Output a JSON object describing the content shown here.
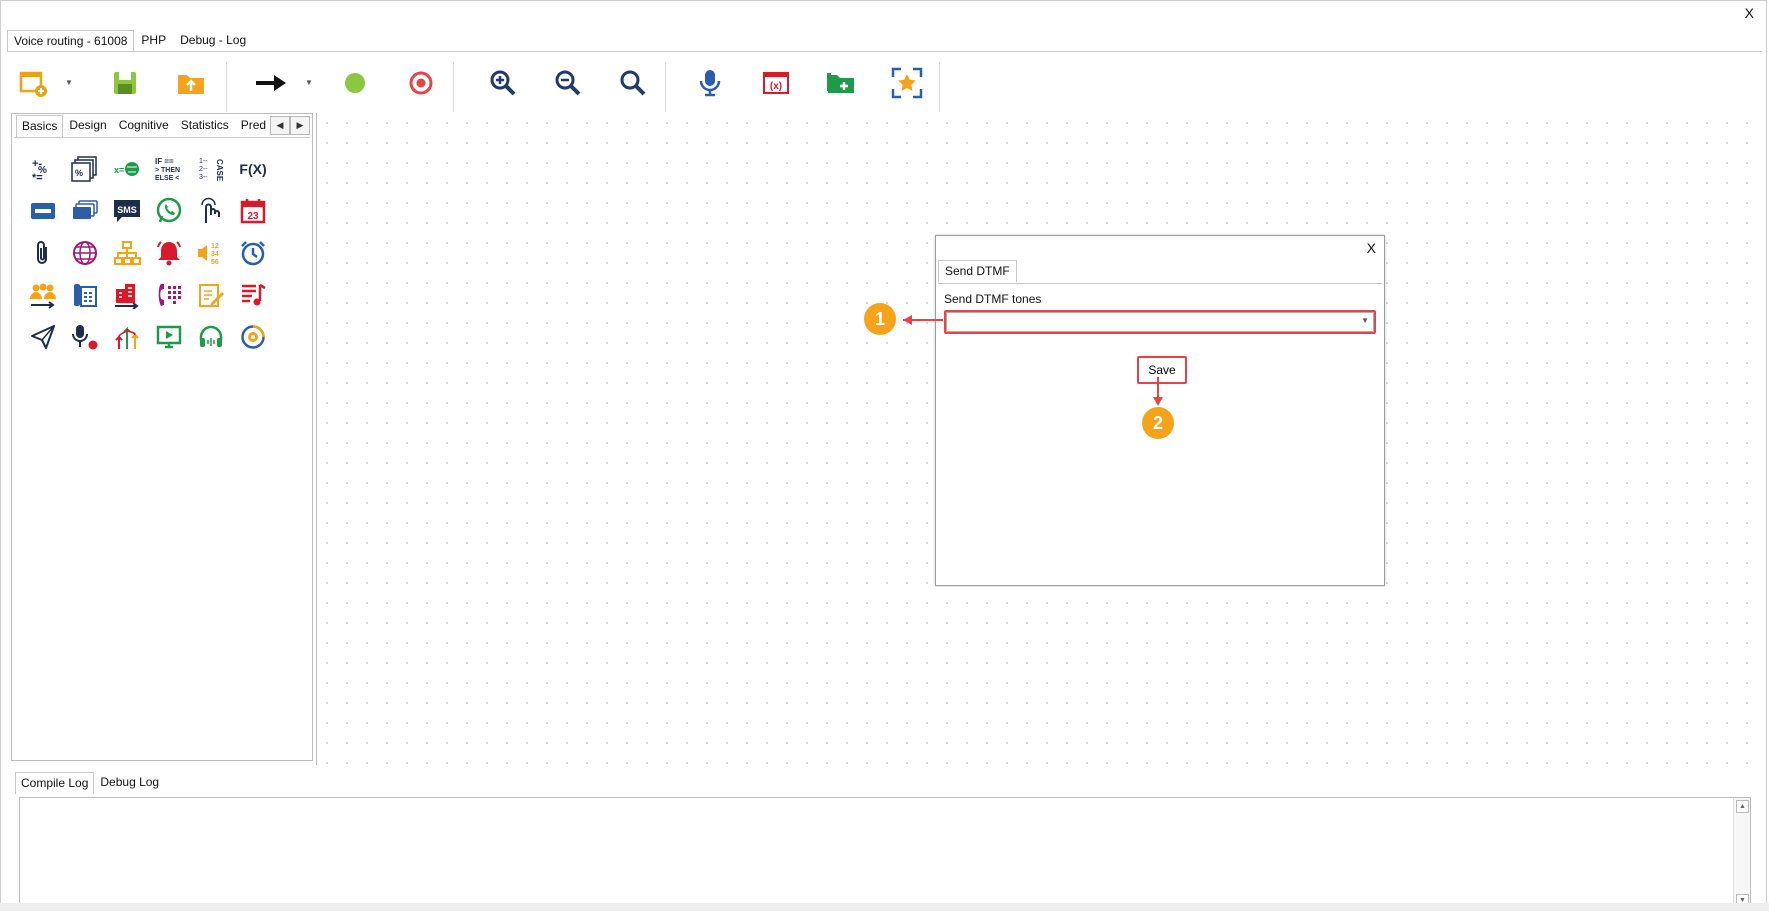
{
  "window": {
    "close_label": "X"
  },
  "main_tabs": [
    {
      "label": "Voice routing - 61008"
    },
    {
      "label": "PHP"
    },
    {
      "label": "Debug - Log"
    }
  ],
  "palette": {
    "tabs": [
      "Basics",
      "Design",
      "Cognitive",
      "Statistics",
      "Pred"
    ],
    "scroll_left": "◀",
    "scroll_right": "▶",
    "icons": [
      "math-operators-icon",
      "percentage-layers-icon",
      "variable-globe-icon",
      "if-then-else-icon",
      "case-icon",
      "function-fx-icon",
      "card-icon",
      "cards-stack-icon",
      "sms-icon",
      "whatsapp-icon",
      "touch-keypad-icon",
      "calendar-23-icon",
      "paperclip-icon",
      "globe-icon",
      "sitemap-icon",
      "alarm-bell-icon",
      "speaker-numbers-icon",
      "alarm-clock-icon",
      "queue-users-icon",
      "desk-phone-icon",
      "building-transfer-icon",
      "phone-keypad-icon",
      "notepad-edit-icon",
      "music-list-icon",
      "send-plane-icon",
      "microphone-record-icon",
      "split-arrows-icon",
      "video-screen-icon",
      "headset-icon",
      "voicemail-ring-icon"
    ],
    "fx_text": "F(X)",
    "sms_text": "SMS",
    "cal_text": "23"
  },
  "dialog": {
    "close_label": "X",
    "tab_label": "Send DTMF",
    "field_label": "Send DTMF tones",
    "select_value": "",
    "save_label": "Save"
  },
  "callouts": {
    "one": "1",
    "two": "2"
  },
  "log": {
    "tabs": [
      "Compile Log",
      "Debug Log"
    ]
  },
  "colors": {
    "accent_red": "#e8434a",
    "callout_orange": "#f5a31a",
    "node_magenta": "#a0177a"
  }
}
